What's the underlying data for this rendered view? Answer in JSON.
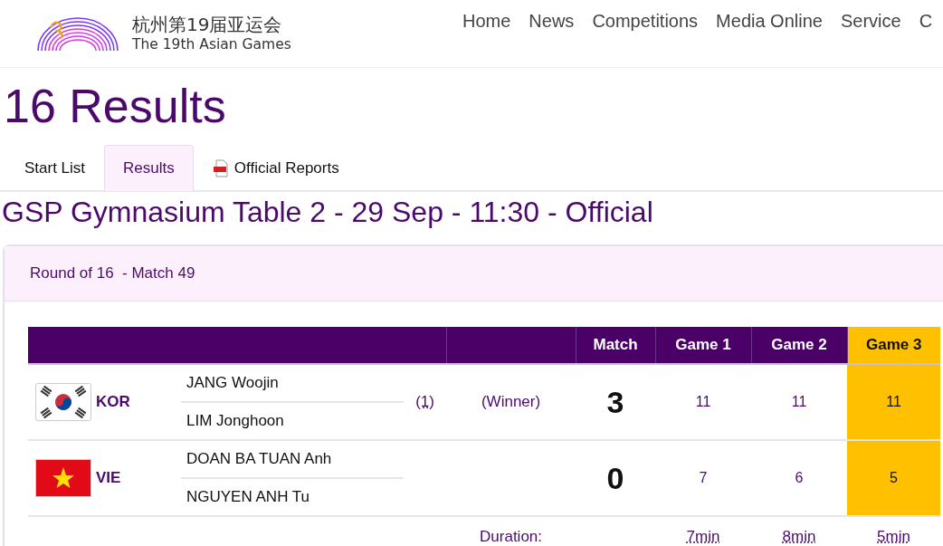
{
  "header": {
    "logo_cn": "杭州第19届亚运会",
    "logo_en": "The 19th Asian Games",
    "nav": [
      "Home",
      "News",
      "Competitions",
      "Media Online",
      "Service",
      "C"
    ]
  },
  "page_title": "16 Results",
  "tabs": [
    {
      "label": "Start List",
      "selected": false,
      "kind": "plain"
    },
    {
      "label": "Results",
      "selected": true,
      "kind": "plain"
    },
    {
      "label": "Official Reports",
      "selected": false,
      "kind": "pdf"
    }
  ],
  "session_title": "GSP Gymnasium Table 2 - 29 Sep - 11:30 - Official",
  "match": {
    "title": "Round of 16  - Match 49",
    "columns": [
      {
        "label": "Match",
        "highlighted": false
      },
      {
        "label": "Game 1",
        "highlighted": false
      },
      {
        "label": "Game 2",
        "highlighted": false
      },
      {
        "label": "Game 3",
        "highlighted": true
      }
    ],
    "teams": [
      {
        "flag": {
          "kind": "kor"
        },
        "noc": "KOR",
        "players": [
          "JANG Woojin",
          "LIM Jonghoon"
        ],
        "seed": "(1)",
        "result": "(Winner)",
        "match_score": "3",
        "games": [
          "11",
          "11",
          "11"
        ]
      },
      {
        "flag": {
          "kind": "vie"
        },
        "noc": "VIE",
        "players": [
          "DOAN BA TUAN Anh",
          "NGUYEN ANH Tu"
        ],
        "match_score": "0",
        "games": [
          "7",
          "6",
          "5"
        ]
      }
    ],
    "duration": {
      "label": "Duration:",
      "games": [
        "7min",
        "8min",
        "5min"
      ]
    }
  }
}
